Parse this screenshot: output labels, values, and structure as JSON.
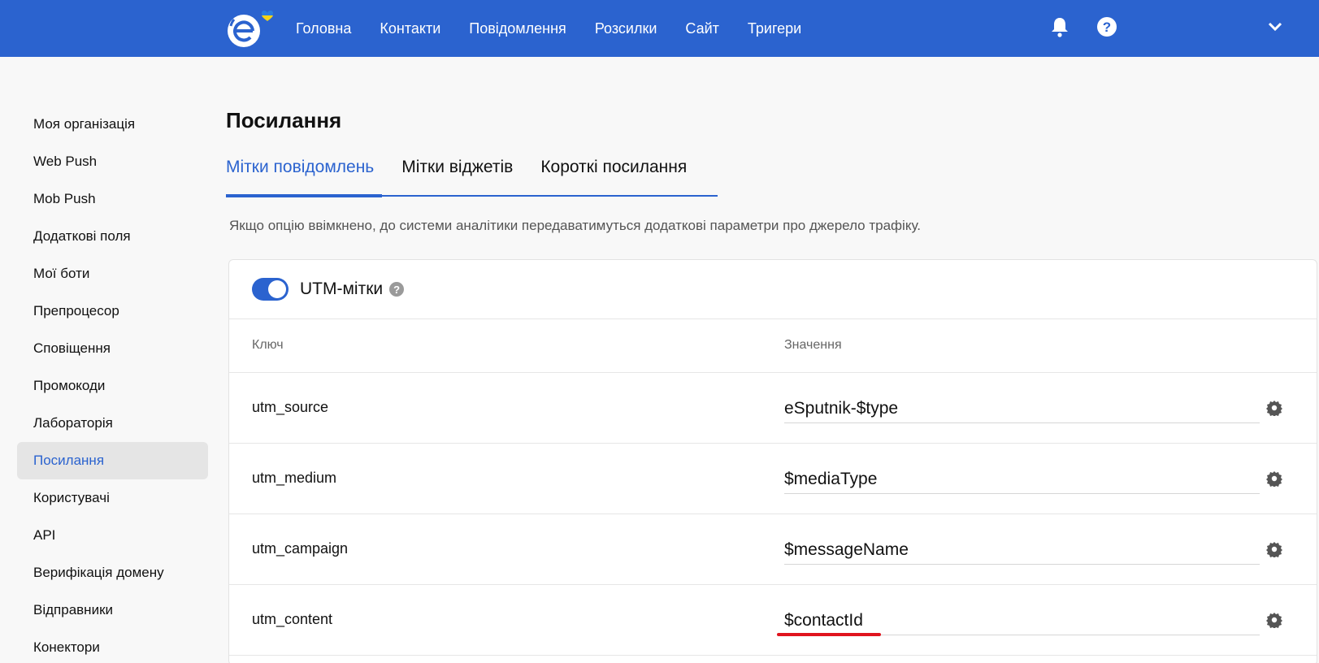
{
  "header": {
    "nav": [
      "Головна",
      "Контакти",
      "Повідомлення",
      "Розсилки",
      "Сайт",
      "Тригери"
    ],
    "icons": [
      "logo-icon",
      "bell-icon",
      "help-icon",
      "chevron-down-icon"
    ],
    "colors": {
      "brand": "#2b63cf"
    }
  },
  "sidebar": {
    "items": [
      {
        "label": "Моя організація"
      },
      {
        "label": "Web Push"
      },
      {
        "label": "Mob Push"
      },
      {
        "label": "Додаткові поля"
      },
      {
        "label": "Мої боти"
      },
      {
        "label": "Препроцесор"
      },
      {
        "label": "Сповіщення"
      },
      {
        "label": "Промокоди"
      },
      {
        "label": "Лабораторія"
      },
      {
        "label": "Посилання"
      },
      {
        "label": "Користувачі"
      },
      {
        "label": "API"
      },
      {
        "label": "Верифікація домену"
      },
      {
        "label": "Відправники"
      },
      {
        "label": "Конектори"
      }
    ],
    "active": "Посилання"
  },
  "main": {
    "title": "Посилання",
    "tabs": [
      "Мітки повідомлень",
      "Мітки віджетів",
      "Короткі посилання"
    ],
    "active_tab": "Мітки повідомлень",
    "description": "Якщо опцію ввімкнено, до системи аналітики передаватимуться додаткові параметри про джерело трафіку."
  },
  "card": {
    "title": "UTM-мітки",
    "toggle_on": true,
    "help": "?",
    "columns": {
      "key": "Ключ",
      "value": "Значення"
    },
    "rows": [
      {
        "key": "utm_source",
        "value": "eSputnik-$type"
      },
      {
        "key": "utm_medium",
        "value": "$mediaType"
      },
      {
        "key": "utm_campaign",
        "value": "$messageName"
      },
      {
        "key": "utm_content",
        "value": "$contactId"
      }
    ],
    "highlight_color": "#e0141e"
  }
}
